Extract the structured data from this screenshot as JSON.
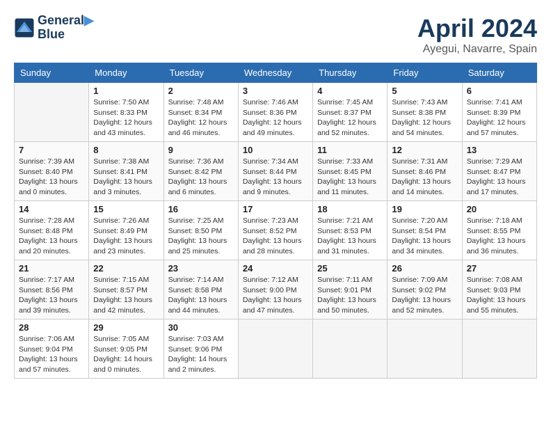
{
  "header": {
    "logo_line1": "General",
    "logo_line2": "Blue",
    "month": "April 2024",
    "location": "Ayegui, Navarre, Spain"
  },
  "days_of_week": [
    "Sunday",
    "Monday",
    "Tuesday",
    "Wednesday",
    "Thursday",
    "Friday",
    "Saturday"
  ],
  "weeks": [
    [
      {
        "day": "",
        "info": ""
      },
      {
        "day": "1",
        "info": "Sunrise: 7:50 AM\nSunset: 8:33 PM\nDaylight: 12 hours\nand 43 minutes."
      },
      {
        "day": "2",
        "info": "Sunrise: 7:48 AM\nSunset: 8:34 PM\nDaylight: 12 hours\nand 46 minutes."
      },
      {
        "day": "3",
        "info": "Sunrise: 7:46 AM\nSunset: 8:36 PM\nDaylight: 12 hours\nand 49 minutes."
      },
      {
        "day": "4",
        "info": "Sunrise: 7:45 AM\nSunset: 8:37 PM\nDaylight: 12 hours\nand 52 minutes."
      },
      {
        "day": "5",
        "info": "Sunrise: 7:43 AM\nSunset: 8:38 PM\nDaylight: 12 hours\nand 54 minutes."
      },
      {
        "day": "6",
        "info": "Sunrise: 7:41 AM\nSunset: 8:39 PM\nDaylight: 12 hours\nand 57 minutes."
      }
    ],
    [
      {
        "day": "7",
        "info": "Sunrise: 7:39 AM\nSunset: 8:40 PM\nDaylight: 13 hours\nand 0 minutes."
      },
      {
        "day": "8",
        "info": "Sunrise: 7:38 AM\nSunset: 8:41 PM\nDaylight: 13 hours\nand 3 minutes."
      },
      {
        "day": "9",
        "info": "Sunrise: 7:36 AM\nSunset: 8:42 PM\nDaylight: 13 hours\nand 6 minutes."
      },
      {
        "day": "10",
        "info": "Sunrise: 7:34 AM\nSunset: 8:44 PM\nDaylight: 13 hours\nand 9 minutes."
      },
      {
        "day": "11",
        "info": "Sunrise: 7:33 AM\nSunset: 8:45 PM\nDaylight: 13 hours\nand 11 minutes."
      },
      {
        "day": "12",
        "info": "Sunrise: 7:31 AM\nSunset: 8:46 PM\nDaylight: 13 hours\nand 14 minutes."
      },
      {
        "day": "13",
        "info": "Sunrise: 7:29 AM\nSunset: 8:47 PM\nDaylight: 13 hours\nand 17 minutes."
      }
    ],
    [
      {
        "day": "14",
        "info": "Sunrise: 7:28 AM\nSunset: 8:48 PM\nDaylight: 13 hours\nand 20 minutes."
      },
      {
        "day": "15",
        "info": "Sunrise: 7:26 AM\nSunset: 8:49 PM\nDaylight: 13 hours\nand 23 minutes."
      },
      {
        "day": "16",
        "info": "Sunrise: 7:25 AM\nSunset: 8:50 PM\nDaylight: 13 hours\nand 25 minutes."
      },
      {
        "day": "17",
        "info": "Sunrise: 7:23 AM\nSunset: 8:52 PM\nDaylight: 13 hours\nand 28 minutes."
      },
      {
        "day": "18",
        "info": "Sunrise: 7:21 AM\nSunset: 8:53 PM\nDaylight: 13 hours\nand 31 minutes."
      },
      {
        "day": "19",
        "info": "Sunrise: 7:20 AM\nSunset: 8:54 PM\nDaylight: 13 hours\nand 34 minutes."
      },
      {
        "day": "20",
        "info": "Sunrise: 7:18 AM\nSunset: 8:55 PM\nDaylight: 13 hours\nand 36 minutes."
      }
    ],
    [
      {
        "day": "21",
        "info": "Sunrise: 7:17 AM\nSunset: 8:56 PM\nDaylight: 13 hours\nand 39 minutes."
      },
      {
        "day": "22",
        "info": "Sunrise: 7:15 AM\nSunset: 8:57 PM\nDaylight: 13 hours\nand 42 minutes."
      },
      {
        "day": "23",
        "info": "Sunrise: 7:14 AM\nSunset: 8:58 PM\nDaylight: 13 hours\nand 44 minutes."
      },
      {
        "day": "24",
        "info": "Sunrise: 7:12 AM\nSunset: 9:00 PM\nDaylight: 13 hours\nand 47 minutes."
      },
      {
        "day": "25",
        "info": "Sunrise: 7:11 AM\nSunset: 9:01 PM\nDaylight: 13 hours\nand 50 minutes."
      },
      {
        "day": "26",
        "info": "Sunrise: 7:09 AM\nSunset: 9:02 PM\nDaylight: 13 hours\nand 52 minutes."
      },
      {
        "day": "27",
        "info": "Sunrise: 7:08 AM\nSunset: 9:03 PM\nDaylight: 13 hours\nand 55 minutes."
      }
    ],
    [
      {
        "day": "28",
        "info": "Sunrise: 7:06 AM\nSunset: 9:04 PM\nDaylight: 13 hours\nand 57 minutes."
      },
      {
        "day": "29",
        "info": "Sunrise: 7:05 AM\nSunset: 9:05 PM\nDaylight: 14 hours\nand 0 minutes."
      },
      {
        "day": "30",
        "info": "Sunrise: 7:03 AM\nSunset: 9:06 PM\nDaylight: 14 hours\nand 2 minutes."
      },
      {
        "day": "",
        "info": ""
      },
      {
        "day": "",
        "info": ""
      },
      {
        "day": "",
        "info": ""
      },
      {
        "day": "",
        "info": ""
      }
    ]
  ]
}
